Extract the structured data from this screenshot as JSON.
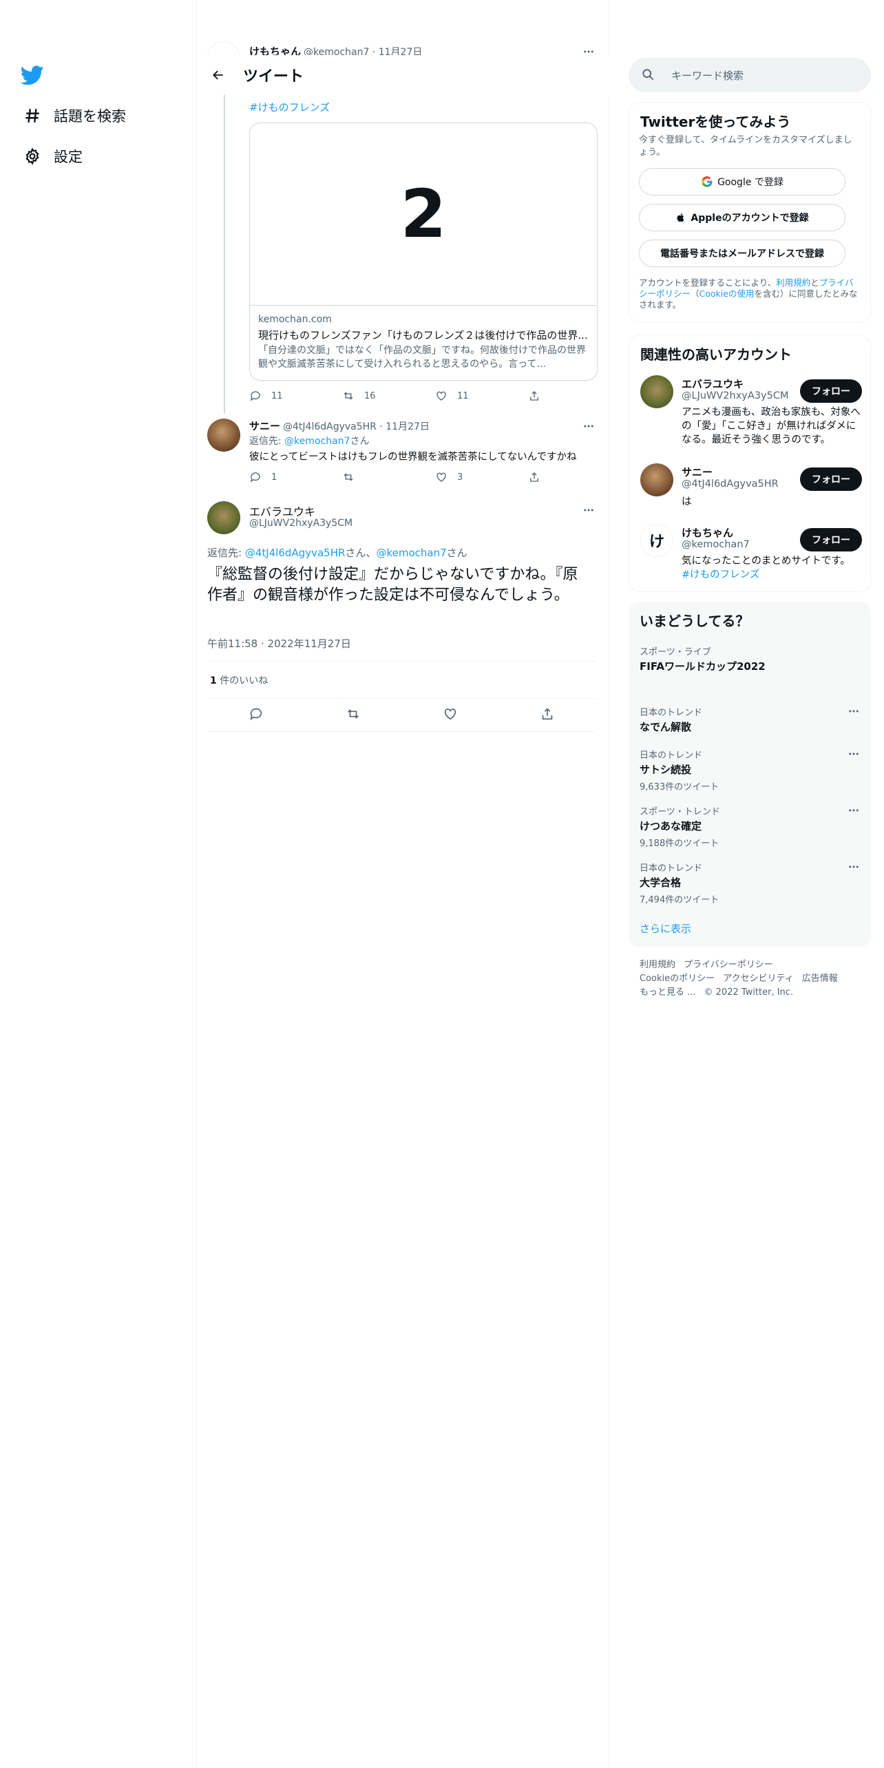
{
  "nav": {
    "items": [
      {
        "label": "話題を検索",
        "icon": "hashtag-icon"
      },
      {
        "label": "設定",
        "icon": "gear-icon"
      }
    ]
  },
  "header": {
    "title": "ツイート"
  },
  "prev_tweet": {
    "name": "けもちゃん",
    "handle_time": "@kemochan7 · 11月27日",
    "hashtag": "#けものフレンズ",
    "card": {
      "image_text": "2",
      "domain": "kemochan.com",
      "title": "現行けものフレンズファン「けものフレンズ２は後付けで作品の世界...",
      "description": "「自分達の文脈」ではなく「作品の文脈」ですね。何故後付けで作品の世界観や文脈滅茶苦茶にして受け入れられると思えるのやら。言って..."
    },
    "replies": "11",
    "retweets": "16",
    "likes": "11"
  },
  "reply_tweet": {
    "name": "サニー",
    "handle_time": "@4tJ4l6dAgyva5HR · 11月27日",
    "reply_prefix": "返信先: ",
    "reply_to": "@kemochan7",
    "reply_suffix": "さん",
    "text": "彼にとってビーストはけもフレの世界観を滅茶苦茶にしてないんですかね",
    "replies": "1",
    "likes": "3"
  },
  "main_tweet": {
    "name": "エバラユウキ",
    "handle": "@LJuWV2hxyA3y5CM",
    "reply_prefix": "返信先: ",
    "reply_to_1": "@4tJ4l6dAgyva5HR",
    "reply_mid": "さん、",
    "reply_to_2": "@kemochan7",
    "reply_suffix": "さん",
    "text": "『総監督の後付け設定』だからじゃないですかね。『原作者』の観音様が作った設定は不可侵なんでしょう。",
    "timestamp": "午前11:58 · 2022年11月27日",
    "likes_count": "1",
    "likes_label": " 件のいいね"
  },
  "search": {
    "placeholder": "キーワード検索"
  },
  "signup": {
    "title": "Twitterを使ってみよう",
    "subtitle": "今すぐ登録して、タイムラインをカスタマイズしましょう。",
    "google": "Google で登録",
    "apple": "Appleのアカウントで登録",
    "phone": "電話番号またはメールアドレスで登録",
    "terms_1": "アカウントを登録することにより、",
    "terms_link_1": "利用規約",
    "terms_2": "と",
    "terms_link_2": "プライバシーポリシー",
    "terms_3": "（",
    "terms_link_3": "Cookieの使用",
    "terms_4": "を含む）に同意したとみなされます。"
  },
  "related": {
    "title": "関連性の高いアカウント",
    "follow_label": "フォロー",
    "accounts": [
      {
        "name": "エバラユウキ",
        "handle": "@LJuWV2hxyA3y5CM",
        "bio": "アニメも漫画も、政治も家族も、対象への「愛」「ここ好き」が無ければダメになる。最近そう強く思うのです。"
      },
      {
        "name": "サニー",
        "handle": "@4tJ4l6dAgyva5HR",
        "bio": "は"
      },
      {
        "name": "けもちゃん",
        "handle": "@kemochan7",
        "bio": "気になったことのまとめサイトです。",
        "bio_link": "#けものフレンズ",
        "avatar_char": "け"
      }
    ]
  },
  "trends": {
    "title": "いまどうしてる？",
    "items": [
      {
        "category": "スポーツ・ライブ",
        "name": "FIFAワールドカップ2022",
        "count": ""
      },
      {
        "category": "日本のトレンド",
        "name": "なでん解散",
        "count": ""
      },
      {
        "category": "日本のトレンド",
        "name": "サトシ続投",
        "count": "9,633件のツイート"
      },
      {
        "category": "スポーツ・トレンド",
        "name": "けつあな確定",
        "count": "9,188件のツイート"
      },
      {
        "category": "日本のトレンド",
        "name": "大学合格",
        "count": "7,494件のツイート"
      }
    ],
    "show_more": "さらに表示"
  },
  "footer": {
    "links": [
      "利用規約",
      "プライバシーポリシー",
      "Cookieのポリシー",
      "アクセシビリティ",
      "広告情報",
      "もっと見る ..."
    ],
    "copyright": "© 2022 Twitter, Inc."
  },
  "colors": {
    "accent": "#1d9bf0",
    "text": "#0f1419",
    "muted": "#536471",
    "border": "#eff3f4"
  }
}
